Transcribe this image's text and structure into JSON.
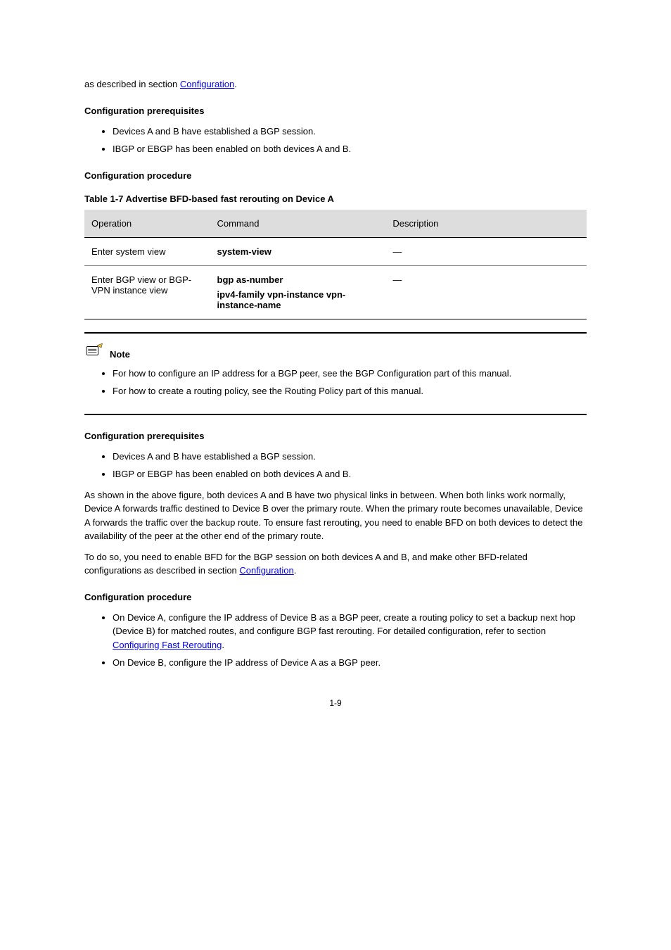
{
  "intro_ref_prefix": "as described in section ",
  "intro_ref_link": "Configuration",
  "intro_ref_period": ".",
  "heading_prereq": "Configuration prerequisites",
  "prereq_items": [
    "Devices A and B have established a BGP session.",
    "IBGP or EBGP has been enabled on both devices A and B."
  ],
  "heading_procedure": "Configuration procedure",
  "table_caption": "Table 1-7 Advertise BFD-based fast rerouting on Device A",
  "table_headers": [
    "Operation",
    "Command",
    "Description"
  ],
  "table_rows": [
    {
      "operation": "Enter system view",
      "command": "system-view",
      "description": "—"
    },
    {
      "operation": "Enter BGP view or BGP-VPN instance view",
      "command_lines": [
        "bgp as-number",
        "ipv4-family vpn-instance vpn-instance-name"
      ],
      "description": "—"
    }
  ],
  "note_label": "Note",
  "note_items": [
    "For how to configure an IP address for a BGP peer, see the BGP Configuration part of this manual.",
    "For how to create a routing policy, see the Routing Policy part of this manual."
  ],
  "heading_prereq2": "Configuration prerequisites",
  "prereq2_items": [
    "Devices A and B have established a BGP session.",
    "IBGP or EBGP has been enabled on both devices A and B."
  ],
  "para_between": "As shown in the above figure, both devices A and B have two physical links in between. When both links work normally, Device A forwards traffic destined to Device B over the primary route. When the primary route becomes unavailable, Device A forwards the traffic over the backup route. To ensure fast rerouting, you need to enable BFD on both devices to detect the availability of the peer at the other end of the primary route.",
  "para_todo_prefix": "To do so, you need to enable BFD for the BGP session on both devices A and B, and make other BFD-related configurations as described in section ",
  "para_todo_link": "Configuration",
  "para_todo_period": ".",
  "heading_procedure2": "Configuration procedure",
  "proc2_items": [
    {
      "text_prefix": "On Device A, configure the IP address of Device B as a BGP peer, create a routing policy to set a backup next hop (Device B) for matched routes, and configure BGP fast rerouting. For detailed configuration, refer to section ",
      "link": "Configuring Fast Rerouting",
      "text_suffix": "."
    },
    {
      "text_prefix": "On Device B, configure the IP address of Device A as a BGP peer.",
      "link": "",
      "text_suffix": ""
    }
  ],
  "page_number": "1-9"
}
